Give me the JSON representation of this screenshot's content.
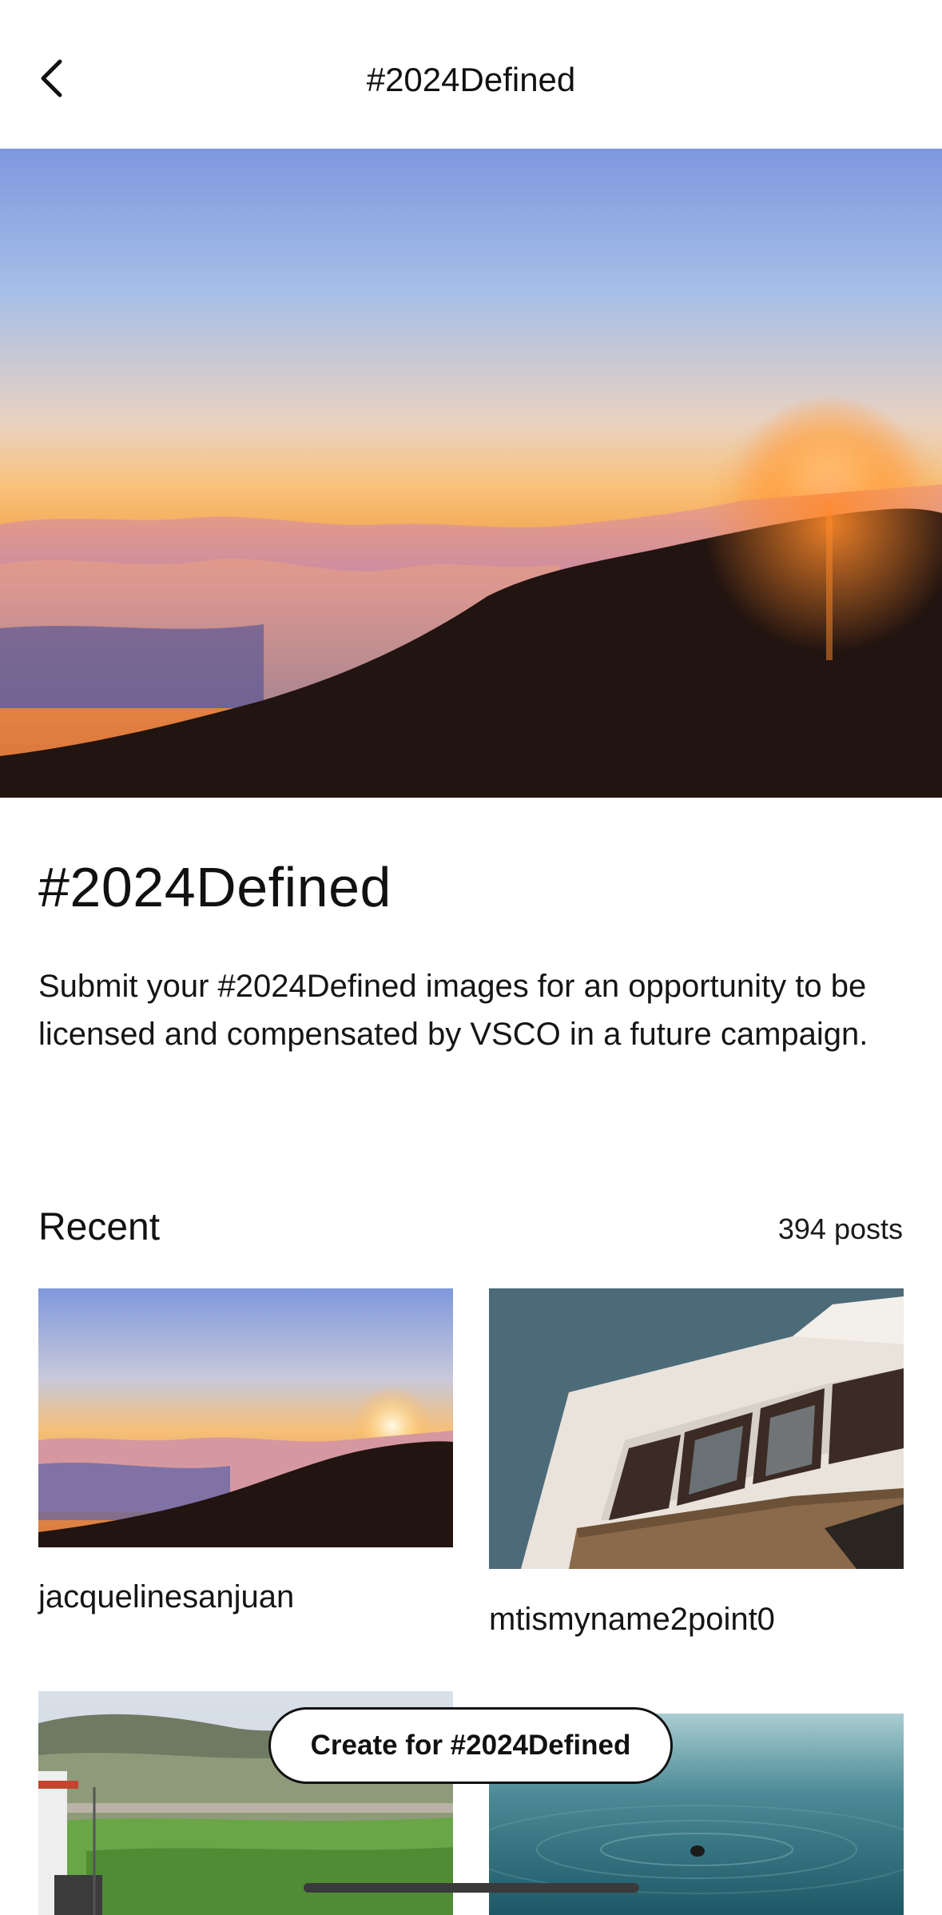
{
  "nav": {
    "title": "#2024Defined",
    "back_icon": "chevron-left-icon"
  },
  "hero": {
    "image": "sunset-over-clouds-mountain"
  },
  "challenge": {
    "title": "#2024Defined",
    "description": "Submit your #2024Defined images for an opportunity to be licensed and compensated by VSCO in a future campaign."
  },
  "recent": {
    "heading": "Recent",
    "count_label": "394 posts",
    "posts": [
      {
        "username": "jacquelinesanjuan",
        "image": "sunset-over-clouds-mountain"
      },
      {
        "username": "mtismyname2point0",
        "image": "white-building-windows-sky"
      },
      {
        "username": "",
        "image": "green-hills-village"
      },
      {
        "username": "",
        "image": "teal-water-swimmer"
      }
    ]
  },
  "create_button": {
    "label": "Create for #2024Defined"
  },
  "colors": {
    "background": "#ffffff",
    "text": "#111111",
    "button_border": "#111111",
    "home_indicator": "#3a3a3a"
  }
}
